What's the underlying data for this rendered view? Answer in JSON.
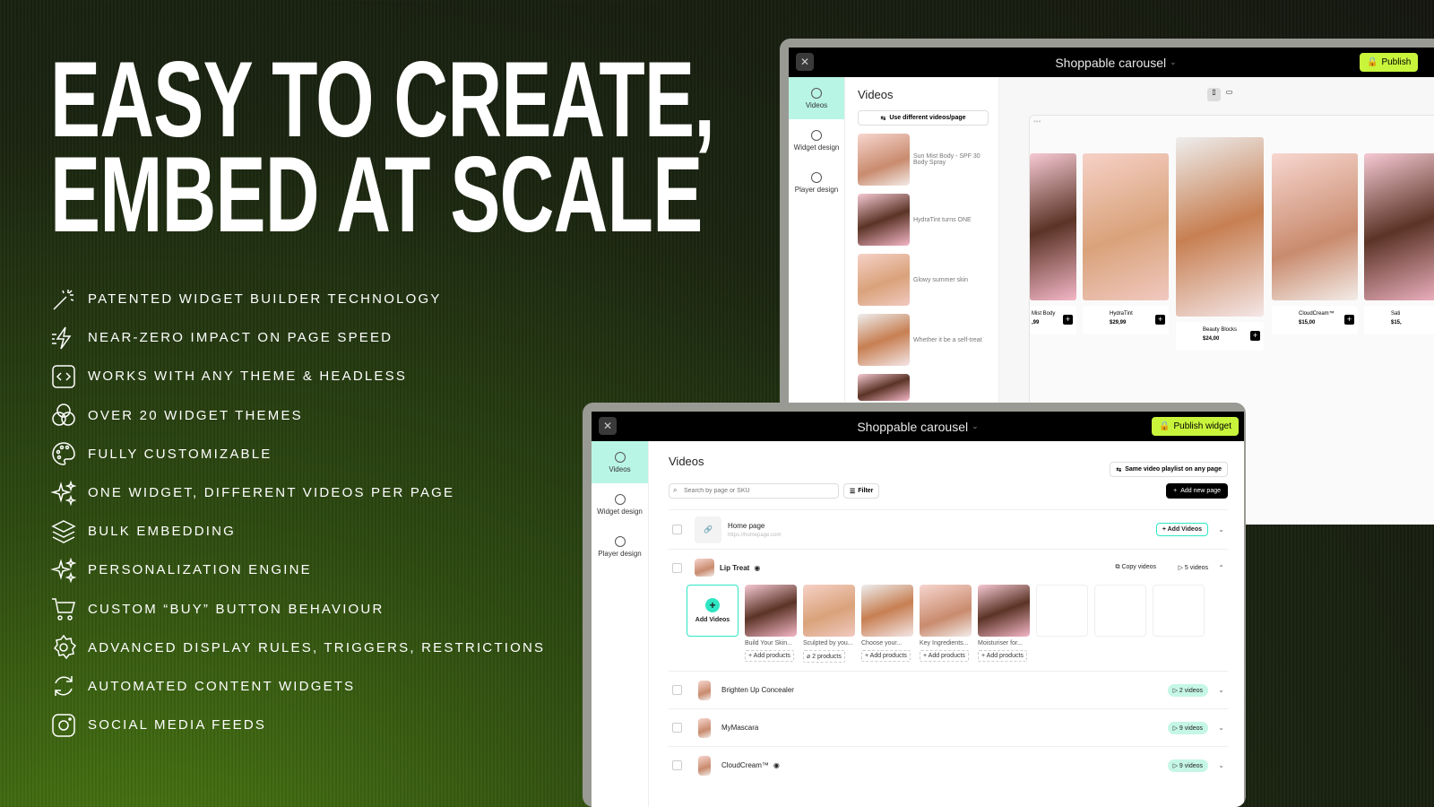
{
  "hero": {
    "line1": "EASY TO CREATE,",
    "line2": "EMBED AT SCALE"
  },
  "features": [
    {
      "icon": "magic-wand-icon",
      "label": "PATENTED WIDGET BUILDER TECHNOLOGY"
    },
    {
      "icon": "lightning-icon",
      "label": "NEAR-ZERO IMPACT ON PAGE SPEED"
    },
    {
      "icon": "code-icon",
      "label": "WORKS WITH ANY THEME & HEADLESS"
    },
    {
      "icon": "circles-icon",
      "label": "OVER 20 WIDGET THEMES"
    },
    {
      "icon": "palette-icon",
      "label": "FULLY CUSTOMIZABLE"
    },
    {
      "icon": "sparkles-icon",
      "label": "ONE WIDGET, DIFFERENT VIDEOS PER PAGE"
    },
    {
      "icon": "layers-icon",
      "label": "BULK EMBEDDING"
    },
    {
      "icon": "sparkles-icon",
      "label": "PERSONALIZATION ENGINE"
    },
    {
      "icon": "cart-icon",
      "label": "CUSTOM “BUY” BUTTON BEHAVIOUR"
    },
    {
      "icon": "gear-icon",
      "label": "ADVANCED DISPLAY RULES, TRIGGERS, RESTRICTIONS"
    },
    {
      "icon": "refresh-icon",
      "label": "AUTOMATED CONTENT WIDGETS"
    },
    {
      "icon": "instagram-icon",
      "label": "SOCIAL MEDIA FEEDS"
    }
  ],
  "sidebar": [
    "Videos",
    "Widget design",
    "Player design"
  ],
  "back": {
    "title": "Shoppable carousel",
    "publish": "Publish",
    "panel_title": "Videos",
    "toggle": "Use different videos/page",
    "videos": [
      "Sun Mist Body - SPF 30 Body Spray",
      "HydraTint turns ONE",
      "Glowy summer skin",
      "Whether it be a self-treat"
    ],
    "cards": [
      {
        "name": "Mist Body",
        "price": ",99"
      },
      {
        "name": "HydraTint",
        "price": "$29,99"
      },
      {
        "name": "Beauty Blocks",
        "price": "$24,00"
      },
      {
        "name": "CloudCream™",
        "price": "$15,00"
      },
      {
        "name": "Sati",
        "price": "$15,"
      }
    ]
  },
  "front": {
    "title": "Shoppable carousel",
    "publish": "Publish widget",
    "panel_title": "Videos",
    "same_playlist": "Same video playlist on any page",
    "search_placeholder": "Search by page or SKU",
    "filter": "Filter",
    "add_page": "Add new page",
    "home": {
      "name": "Home page",
      "url": "https://homepage.com",
      "add": "Add Videos"
    },
    "lip": {
      "name": "Lip Treat",
      "copy": "Copy videos",
      "count": "5 videos",
      "add_tile": "Add Videos",
      "videos": [
        {
          "title": "Build Your Skin...",
          "products": "Add products"
        },
        {
          "title": "Sculpted by you...",
          "products": "2 products"
        },
        {
          "title": "Choose your...",
          "products": "Add products"
        },
        {
          "title": "Key Ingredients...",
          "products": "Add products"
        },
        {
          "title": "Moisturiser for...",
          "products": "Add products"
        }
      ]
    },
    "rows": [
      {
        "name": "Brighten Up Concealer",
        "count": "2 videos"
      },
      {
        "name": "MyMascara",
        "count": "9 videos"
      },
      {
        "name": "CloudCream™",
        "count": "9 videos"
      }
    ]
  },
  "colors": {
    "accent": "#c8f53c",
    "mint": "#b8f5e4",
    "teal": "#2ee6c4"
  }
}
